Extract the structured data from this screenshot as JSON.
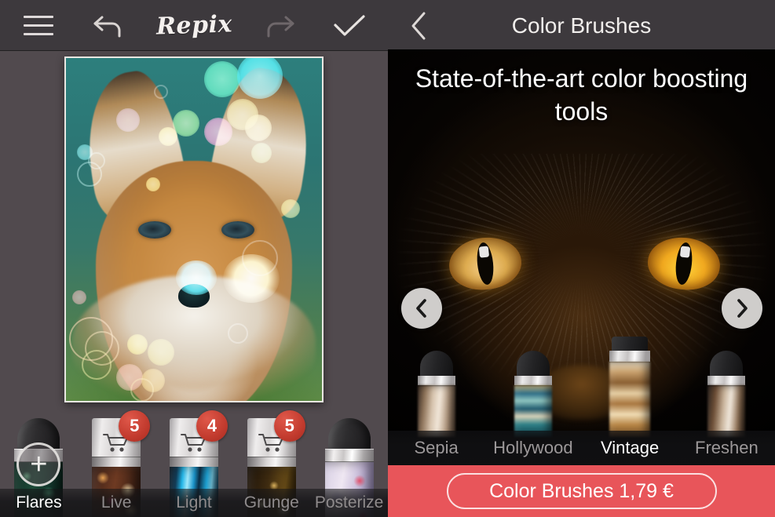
{
  "editor": {
    "toolbar": {
      "menu_icon": "hamburger-menu-icon",
      "undo_icon": "undo-arrow-icon",
      "brand": "Repix",
      "redo_icon": "redo-arrow-icon",
      "confirm_icon": "checkmark-icon"
    },
    "photo": {
      "name": "fox-photo",
      "description": "Red fox face with colorful bokeh flare overlay"
    },
    "add_button_label": "+",
    "brushes": [
      {
        "label": "Flares",
        "selected": true,
        "badge": null,
        "locked": false,
        "icon": "brush-flares"
      },
      {
        "label": "Live",
        "selected": false,
        "badge": "5",
        "locked": true,
        "icon": "cart-icon"
      },
      {
        "label": "Light",
        "selected": false,
        "badge": "4",
        "locked": true,
        "icon": "cart-icon"
      },
      {
        "label": "Grunge",
        "selected": false,
        "badge": "5",
        "locked": true,
        "icon": "cart-icon"
      },
      {
        "label": "Posterize",
        "selected": false,
        "badge": null,
        "locked": false,
        "icon": "brush-posterize"
      }
    ]
  },
  "store": {
    "back_icon": "chevron-left-icon",
    "title": "Color Brushes",
    "headline": "State-of-the-art color boosting tools",
    "hero": {
      "name": "cat-photo",
      "description": "Close-up of black cat with glowing amber eyes"
    },
    "prev_icon": "chevron-left-circle-icon",
    "next_icon": "chevron-right-circle-icon",
    "brushes": [
      {
        "label": "Sepia",
        "selected": false
      },
      {
        "label": "Hollywood",
        "selected": false
      },
      {
        "label": "Vintage",
        "selected": true
      },
      {
        "label": "Freshen",
        "selected": false
      }
    ],
    "buy_label": "Color Brushes 1,79 €"
  },
  "colors": {
    "panel_bg": "#514a4e",
    "topbar_bg": "#3d393d",
    "accent_red": "#e8555a",
    "badge_red": "#c23b2e",
    "text_light": "#f1eeec",
    "text_muted": "#8f8b8c"
  }
}
